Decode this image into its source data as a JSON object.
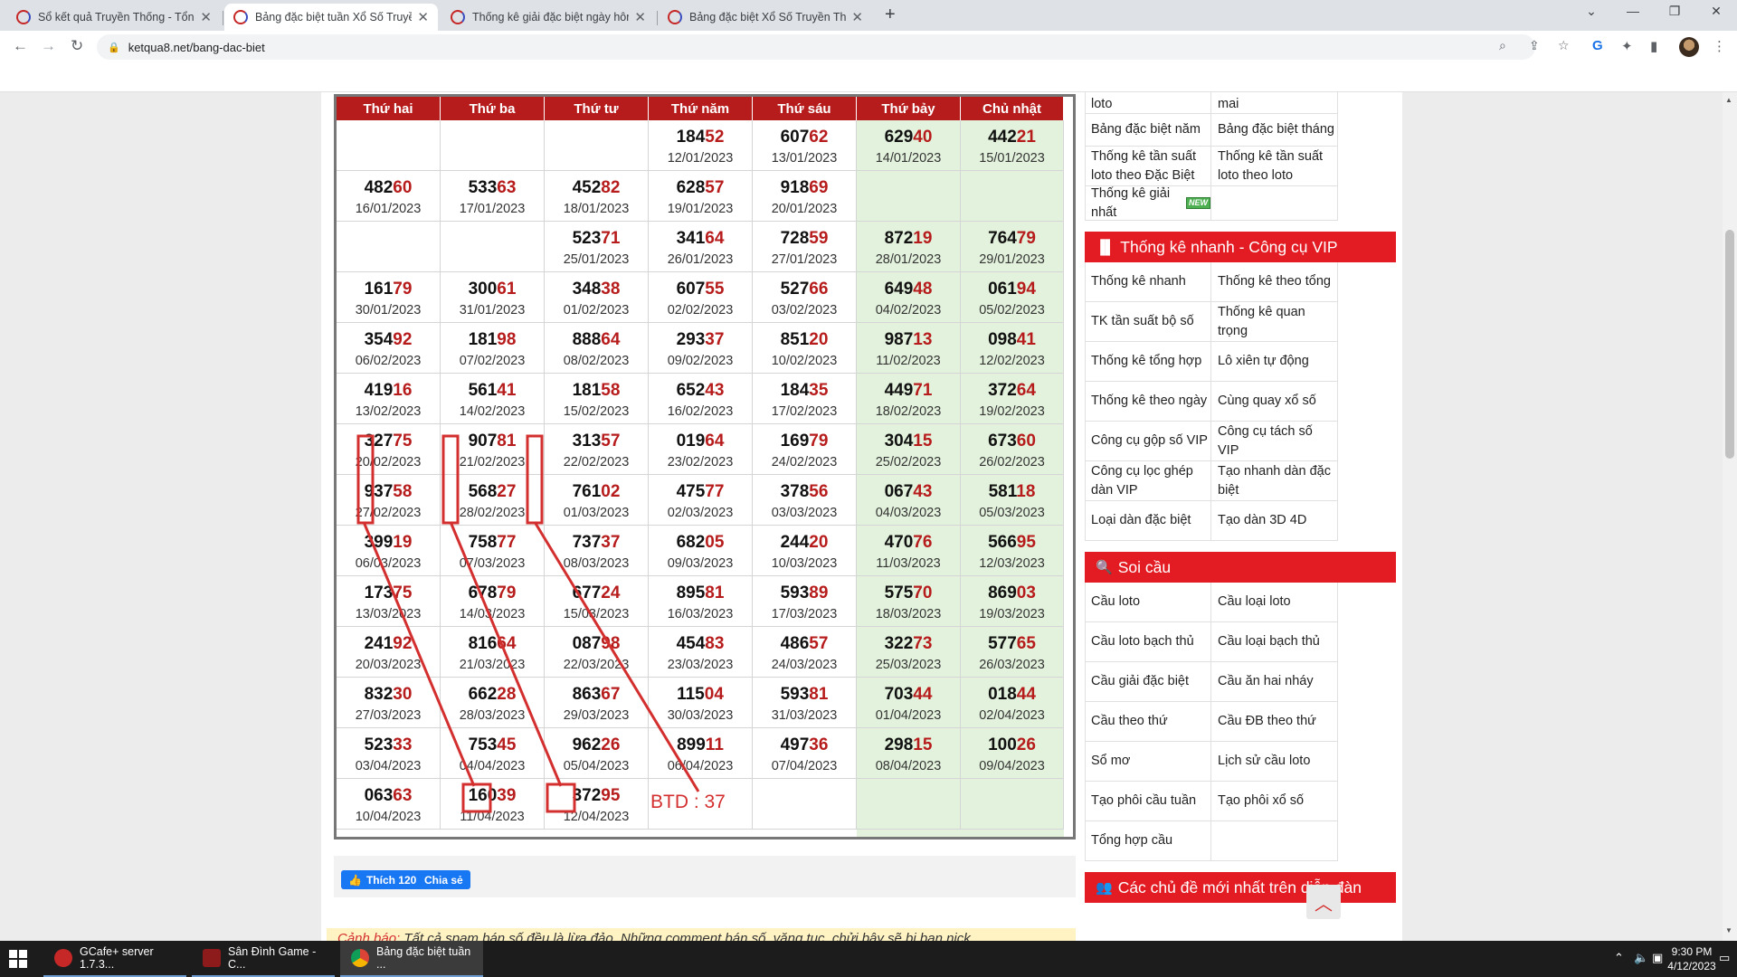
{
  "browser": {
    "tabs": [
      {
        "title": "Sổ kết quả Truyền Thống - Tổng",
        "active": false
      },
      {
        "title": "Bảng đặc biệt tuần Xổ Số Truyền",
        "active": true
      },
      {
        "title": "Thống kê giải đặc biệt ngày hôm",
        "active": false
      },
      {
        "title": "Bảng đặc biệt Xổ Số Truyền Thốn",
        "active": false
      }
    ],
    "url": "ketqua8.net/bang-dac-biet"
  },
  "table": {
    "headers": [
      "Thứ hai",
      "Thứ ba",
      "Thứ tư",
      "Thứ năm",
      "Thứ sáu",
      "Thứ bảy",
      "Chủ nhật"
    ],
    "rows": [
      [
        null,
        null,
        null,
        {
          "h": "184",
          "t": "52",
          "d": "12/01/2023"
        },
        {
          "h": "607",
          "t": "62",
          "d": "13/01/2023"
        },
        {
          "h": "629",
          "t": "40",
          "d": "14/01/2023"
        },
        {
          "h": "442",
          "t": "21",
          "d": "15/01/2023"
        }
      ],
      [
        {
          "h": "482",
          "t": "60",
          "d": "16/01/2023"
        },
        {
          "h": "533",
          "t": "63",
          "d": "17/01/2023"
        },
        {
          "h": "452",
          "t": "82",
          "d": "18/01/2023"
        },
        {
          "h": "628",
          "t": "57",
          "d": "19/01/2023"
        },
        {
          "h": "918",
          "t": "69",
          "d": "20/01/2023"
        },
        null,
        null
      ],
      [
        null,
        null,
        {
          "h": "523",
          "t": "71",
          "d": "25/01/2023"
        },
        {
          "h": "341",
          "t": "64",
          "d": "26/01/2023"
        },
        {
          "h": "728",
          "t": "59",
          "d": "27/01/2023"
        },
        {
          "h": "872",
          "t": "19",
          "d": "28/01/2023"
        },
        {
          "h": "764",
          "t": "79",
          "d": "29/01/2023"
        }
      ],
      [
        {
          "h": "161",
          "t": "79",
          "d": "30/01/2023"
        },
        {
          "h": "300",
          "t": "61",
          "d": "31/01/2023"
        },
        {
          "h": "348",
          "t": "38",
          "d": "01/02/2023"
        },
        {
          "h": "607",
          "t": "55",
          "d": "02/02/2023"
        },
        {
          "h": "527",
          "t": "66",
          "d": "03/02/2023"
        },
        {
          "h": "649",
          "t": "48",
          "d": "04/02/2023"
        },
        {
          "h": "061",
          "t": "94",
          "d": "05/02/2023"
        }
      ],
      [
        {
          "h": "354",
          "t": "92",
          "d": "06/02/2023"
        },
        {
          "h": "181",
          "t": "98",
          "d": "07/02/2023"
        },
        {
          "h": "888",
          "t": "64",
          "d": "08/02/2023"
        },
        {
          "h": "293",
          "t": "37",
          "d": "09/02/2023"
        },
        {
          "h": "851",
          "t": "20",
          "d": "10/02/2023"
        },
        {
          "h": "987",
          "t": "13",
          "d": "11/02/2023"
        },
        {
          "h": "098",
          "t": "41",
          "d": "12/02/2023"
        }
      ],
      [
        {
          "h": "419",
          "t": "16",
          "d": "13/02/2023"
        },
        {
          "h": "561",
          "t": "41",
          "d": "14/02/2023"
        },
        {
          "h": "181",
          "t": "58",
          "d": "15/02/2023"
        },
        {
          "h": "652",
          "t": "43",
          "d": "16/02/2023"
        },
        {
          "h": "184",
          "t": "35",
          "d": "17/02/2023"
        },
        {
          "h": "449",
          "t": "71",
          "d": "18/02/2023"
        },
        {
          "h": "372",
          "t": "64",
          "d": "19/02/2023"
        }
      ],
      [
        {
          "h": "327",
          "t": "75",
          "d": "20/02/2023"
        },
        {
          "h": "907",
          "t": "81",
          "d": "21/02/2023"
        },
        {
          "h": "313",
          "t": "57",
          "d": "22/02/2023"
        },
        {
          "h": "019",
          "t": "64",
          "d": "23/02/2023"
        },
        {
          "h": "169",
          "t": "79",
          "d": "24/02/2023"
        },
        {
          "h": "304",
          "t": "15",
          "d": "25/02/2023"
        },
        {
          "h": "673",
          "t": "60",
          "d": "26/02/2023"
        }
      ],
      [
        {
          "h": "937",
          "t": "58",
          "d": "27/02/2023"
        },
        {
          "h": "568",
          "t": "27",
          "d": "28/02/2023"
        },
        {
          "h": "761",
          "t": "02",
          "d": "01/03/2023"
        },
        {
          "h": "475",
          "t": "77",
          "d": "02/03/2023"
        },
        {
          "h": "378",
          "t": "56",
          "d": "03/03/2023"
        },
        {
          "h": "067",
          "t": "43",
          "d": "04/03/2023"
        },
        {
          "h": "581",
          "t": "18",
          "d": "05/03/2023"
        }
      ],
      [
        {
          "h": "399",
          "t": "19",
          "d": "06/03/2023"
        },
        {
          "h": "758",
          "t": "77",
          "d": "07/03/2023"
        },
        {
          "h": "737",
          "t": "37",
          "d": "08/03/2023"
        },
        {
          "h": "682",
          "t": "05",
          "d": "09/03/2023"
        },
        {
          "h": "244",
          "t": "20",
          "d": "10/03/2023"
        },
        {
          "h": "470",
          "t": "76",
          "d": "11/03/2023"
        },
        {
          "h": "566",
          "t": "95",
          "d": "12/03/2023"
        }
      ],
      [
        {
          "h": "173",
          "t": "75",
          "d": "13/03/2023"
        },
        {
          "h": "678",
          "t": "79",
          "d": "14/03/2023"
        },
        {
          "h": "677",
          "t": "24",
          "d": "15/03/2023"
        },
        {
          "h": "895",
          "t": "81",
          "d": "16/03/2023"
        },
        {
          "h": "593",
          "t": "89",
          "d": "17/03/2023"
        },
        {
          "h": "575",
          "t": "70",
          "d": "18/03/2023"
        },
        {
          "h": "869",
          "t": "03",
          "d": "19/03/2023"
        }
      ],
      [
        {
          "h": "241",
          "t": "92",
          "d": "20/03/2023"
        },
        {
          "h": "816",
          "t": "64",
          "d": "21/03/2023"
        },
        {
          "h": "087",
          "t": "98",
          "d": "22/03/2023"
        },
        {
          "h": "454",
          "t": "83",
          "d": "23/03/2023"
        },
        {
          "h": "486",
          "t": "57",
          "d": "24/03/2023"
        },
        {
          "h": "322",
          "t": "73",
          "d": "25/03/2023"
        },
        {
          "h": "577",
          "t": "65",
          "d": "26/03/2023"
        }
      ],
      [
        {
          "h": "832",
          "t": "30",
          "d": "27/03/2023"
        },
        {
          "h": "662",
          "t": "28",
          "d": "28/03/2023"
        },
        {
          "h": "863",
          "t": "67",
          "d": "29/03/2023"
        },
        {
          "h": "115",
          "t": "04",
          "d": "30/03/2023"
        },
        {
          "h": "593",
          "t": "81",
          "d": "31/03/2023"
        },
        {
          "h": "703",
          "t": "44",
          "d": "01/04/2023"
        },
        {
          "h": "018",
          "t": "44",
          "d": "02/04/2023"
        }
      ],
      [
        {
          "h": "523",
          "t": "33",
          "d": "03/04/2023"
        },
        {
          "h": "753",
          "t": "45",
          "d": "04/04/2023"
        },
        {
          "h": "962",
          "t": "26",
          "d": "05/04/2023"
        },
        {
          "h": "899",
          "t": "11",
          "d": "06/04/2023"
        },
        {
          "h": "497",
          "t": "36",
          "d": "07/04/2023"
        },
        {
          "h": "298",
          "t": "15",
          "d": "08/04/2023"
        },
        {
          "h": "100",
          "t": "26",
          "d": "09/04/2023"
        }
      ],
      [
        {
          "h": "063",
          "t": "63",
          "d": "10/04/2023"
        },
        {
          "h": "160",
          "t": "39",
          "d": "11/04/2023"
        },
        {
          "h": "372",
          "t": "95",
          "d": "12/04/2023"
        },
        null,
        null,
        null,
        null
      ]
    ],
    "annotation_text": "BTD : 37",
    "annotation_color": "#d32f2f"
  },
  "social": {
    "like_label": "Thích 120",
    "share_label": "Chia sẻ"
  },
  "warning": {
    "lead": "Cảnh báo:",
    "text": " Tất cả spam bán số đều là lừa đảo. Những comment bán số, văng tục, chửi bậy sẽ bị ban nick."
  },
  "sidebar": {
    "group1": [
      [
        "Thống kê đầu đuôi loto",
        "Thống kê ĐB ngày mai"
      ],
      [
        "Bảng đặc biệt năm",
        "Bảng đặc biệt tháng"
      ],
      [
        "Thống kê tần suất loto theo Đặc Biệt",
        "Thống kê tần suất loto theo loto"
      ],
      [
        "Thống kê giải nhất",
        ""
      ]
    ],
    "new_badge": "NEW",
    "head2": "Thống kê nhanh - Công cụ VIP",
    "group2": [
      [
        "Thống kê nhanh",
        "Thống kê theo tổng"
      ],
      [
        "TK tần suất bộ số",
        "Thống kê quan trọng"
      ],
      [
        "Thống kê tổng hợp",
        "Lô xiên tự động"
      ],
      [
        "Thống kê theo ngày",
        "Cùng quay xổ số"
      ],
      [
        "Công cụ gộp số VIP",
        "Công cụ tách số VIP"
      ],
      [
        "Công cụ lọc ghép dàn VIP",
        "Tạo nhanh dàn đặc biệt"
      ],
      [
        "Loại dàn đặc biệt",
        "Tạo dàn 3D 4D"
      ]
    ],
    "head3": "Soi cầu",
    "group3": [
      [
        "Cầu loto",
        "Cầu loại loto"
      ],
      [
        "Cầu loto bạch thủ",
        "Cầu loại bạch thủ"
      ],
      [
        "Cầu giải đặc biệt",
        "Cầu ăn hai nháy"
      ],
      [
        "Cầu theo thứ",
        "Cầu ĐB theo thứ"
      ],
      [
        "Sổ mơ",
        "Lịch sử cầu loto"
      ],
      [
        "Tạo phôi cầu tuần",
        "Tạo phôi xổ số"
      ],
      [
        "Tổng hợp cầu",
        ""
      ]
    ],
    "head4": "Các chủ đề mới nhất trên diễn đàn",
    "header_color": "#e31b23"
  },
  "taskbar": {
    "tasks": [
      "GCafe+ server 1.7.3...",
      "Sân Đình Game - C...",
      "Bảng đặc biệt tuần ..."
    ],
    "time": "9:30 PM",
    "date": "4/12/2023"
  },
  "colors": {
    "header_red": "#b71c1c",
    "weekend_green": "#e3f2dc",
    "tail_red": "#b71c1c"
  },
  "icons": {
    "back": "arrow-left-icon",
    "forward": "arrow-right-icon",
    "reload": "reload-icon",
    "zoom": "zoom-icon",
    "share": "share-icon",
    "bookmark": "star-icon",
    "translate": "translate-icon",
    "extensions": "puzzle-icon",
    "sidepanel": "side-panel-icon",
    "menu": "kebab-menu-icon",
    "chart": "bar-chart-icon",
    "search": "search-icon",
    "users": "users-icon",
    "scroll_top": "chevron-up-icon"
  }
}
